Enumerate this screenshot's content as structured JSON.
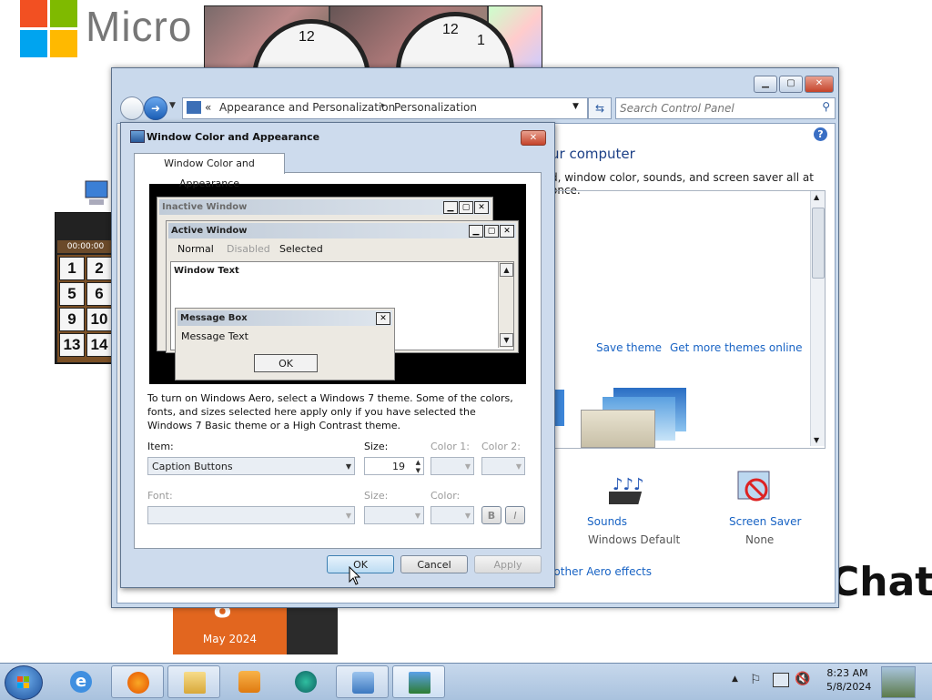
{
  "desktop": {
    "brand_text": "Micro",
    "puzzle_timer": "00:00:00",
    "puzzle_numbers": [
      "1",
      "2",
      "5",
      "6",
      "9",
      "10",
      "13",
      "14"
    ],
    "calendar_month": "May 2024",
    "chat_text": "Chat",
    "clock_numerals": [
      "12",
      "12",
      "1"
    ]
  },
  "control_panel": {
    "breadcrumb_prefix": "«",
    "breadcrumb_1": "Appearance and Personalization",
    "breadcrumb_sep": "▸",
    "breadcrumb_2": "Personalization",
    "search_placeholder": "Search Control Panel",
    "heading_fragment": "ur computer",
    "subtext_fragment": "d, window color, sounds, and screen saver all at once.",
    "save_theme": "Save theme",
    "get_more_themes": "Get more themes online",
    "sounds_label": "Sounds",
    "sounds_value": "Windows Default",
    "screensaver_label": "Screen Saver",
    "screensaver_value": "None",
    "aero_link": "d other Aero effects"
  },
  "dialog": {
    "title": "Window Color and Appearance",
    "tab": "Window Color and Appearance",
    "preview": {
      "inactive_title": "Inactive Window",
      "active_title": "Active Window",
      "menu_normal": "Normal",
      "menu_disabled": "Disabled",
      "menu_selected": "Selected",
      "window_text": "Window Text",
      "msgbox_title": "Message Box",
      "msgbox_text": "Message Text",
      "msgbox_ok": "OK"
    },
    "info_text": "To turn on Windows Aero, select a Windows 7 theme.  Some of the colors, fonts, and sizes selected here apply only if you have selected the Windows 7 Basic theme or a High Contrast theme.",
    "item_label": "Item:",
    "item_value": "Caption Buttons",
    "size_label": "Size:",
    "size_value": "19",
    "color1_label": "Color 1:",
    "color2_label": "Color 2:",
    "font_label": "Font:",
    "font_size_label": "Size:",
    "font_color_label": "Color:",
    "bold_label": "B",
    "italic_label": "I",
    "ok": "OK",
    "cancel": "Cancel",
    "apply": "Apply"
  },
  "taskbar": {
    "time": "8:23 AM",
    "date": "5/8/2024",
    "items": [
      "ie-icon",
      "firefox-icon",
      "explorer-icon",
      "media-player-icon",
      "app-icon",
      "remote-icon",
      "control-panel-icon"
    ]
  },
  "colors": {
    "accent_link": "#1863c4",
    "window_frame": "#c9d9ec",
    "taskbar": "#b9cde6"
  }
}
